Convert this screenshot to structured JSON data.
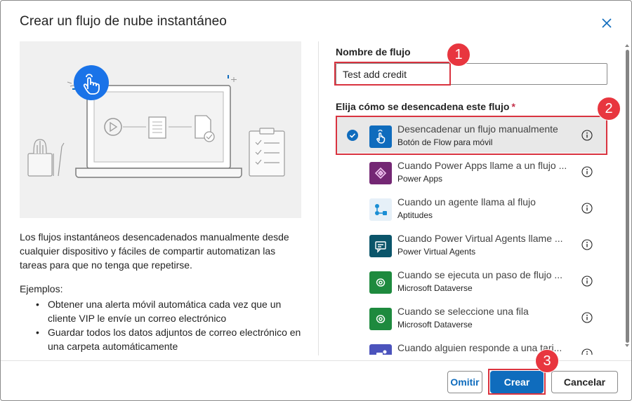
{
  "dialog": {
    "title": "Crear un flujo de nube instantáneo",
    "close_icon": "close-icon"
  },
  "left": {
    "description": "Los flujos instantáneos desencadenados manualmente desde cualquier dispositivo y fáciles de compartir automatizan las tareas para que no tenga que repetirse.",
    "examples_title": "Ejemplos:",
    "examples": [
      "Obtener una alerta móvil automática cada vez que un cliente VIP le envíe un correo electrónico",
      "Guardar todos los datos adjuntos de correo electrónico en una carpeta automáticamente"
    ]
  },
  "form": {
    "name_label": "Nombre de flujo",
    "name_value": "Test add credit",
    "trigger_label": "Elija cómo se desencadena este flujo",
    "required_mark": "*"
  },
  "triggers": [
    {
      "title": "Desencadenar un flujo manualmente",
      "subtitle": "Botón de Flow para móvil",
      "icon": "touch-icon",
      "color": "#0f6cbd",
      "selected": true
    },
    {
      "title": "Cuando Power Apps llame a un flujo ...",
      "subtitle": "Power Apps",
      "icon": "power-apps-icon",
      "color": "#742774",
      "selected": false
    },
    {
      "title": "Cuando un agente llama al flujo",
      "subtitle": "Aptitudes",
      "icon": "agent-flow-icon",
      "color": "#dcebf5",
      "selected": false
    },
    {
      "title": "Cuando Power Virtual Agents llame ...",
      "subtitle": "Power Virtual Agents",
      "icon": "chat-bot-icon",
      "color": "#0b556a",
      "selected": false
    },
    {
      "title": "Cuando se ejecuta un paso de flujo ...",
      "subtitle": "Microsoft Dataverse",
      "icon": "dataverse-icon",
      "color": "#1e8a3e",
      "selected": false
    },
    {
      "title": "Cuando se seleccione una fila",
      "subtitle": "Microsoft Dataverse",
      "icon": "dataverse-icon",
      "color": "#1e8a3e",
      "selected": false
    },
    {
      "title": "Cuando alguien responde a una tarj...",
      "subtitle": "",
      "icon": "teams-icon",
      "color": "#4b53bc",
      "selected": false
    }
  ],
  "footer": {
    "skip_label": "Omitir",
    "create_label": "Crear",
    "cancel_label": "Cancelar"
  },
  "annotations": [
    "1",
    "2",
    "3"
  ]
}
